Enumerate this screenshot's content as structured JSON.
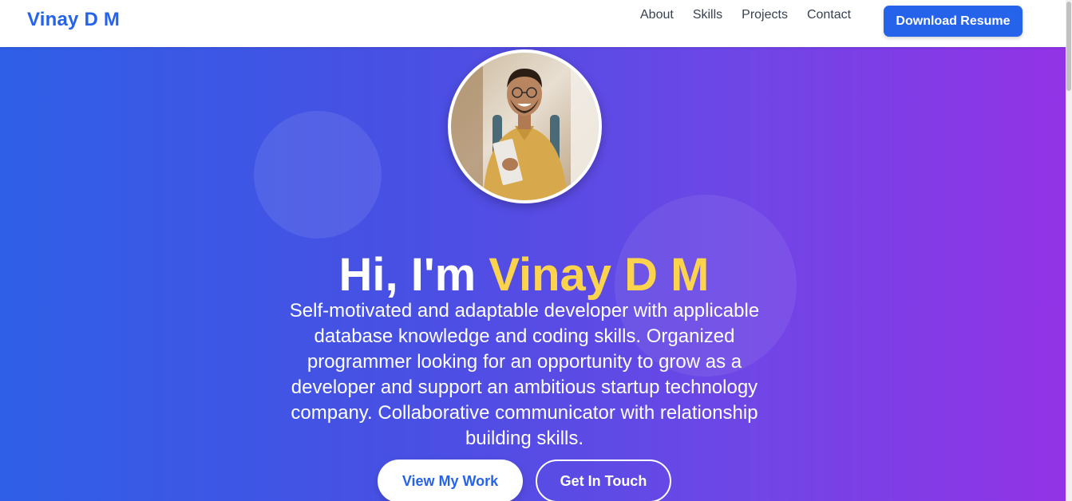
{
  "header": {
    "brand": "Vinay D M",
    "nav": [
      "About",
      "Skills",
      "Projects",
      "Contact"
    ],
    "cta": "Download Resume"
  },
  "hero": {
    "avatar_alt": "profile-photo",
    "greeting": "Hi, I'm",
    "name": "Vinay D M",
    "bio": "Self-motivated and adaptable developer with applicable database knowledge and coding skills. Organized programmer looking for an opportunity to grow as a developer and support an ambitious startup technology company. Collaborative communicator with relationship building skills.",
    "primary_button": "View My Work",
    "secondary_button": "Get In Touch"
  },
  "colors": {
    "brand": "#2563eb",
    "highlight": "#fcd34d",
    "gradient_start": "#2f5fe6",
    "gradient_end": "#9233e6"
  }
}
